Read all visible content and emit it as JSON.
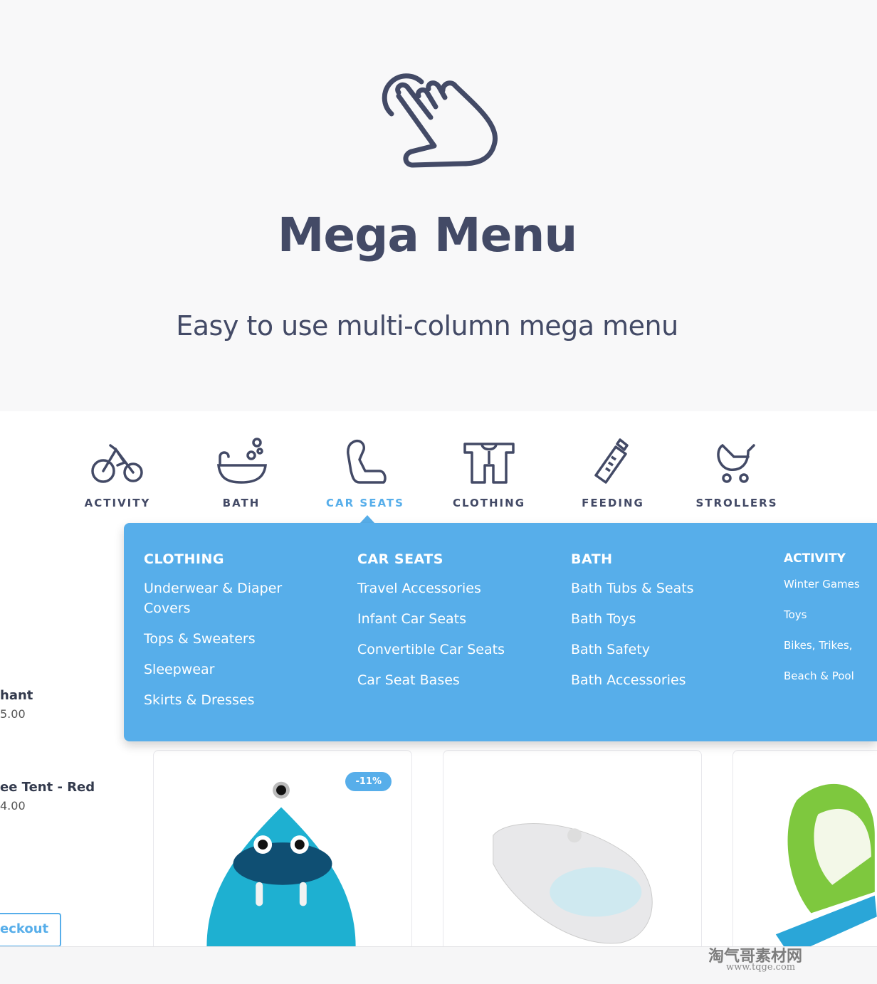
{
  "hero": {
    "title": "Mega Menu",
    "subtitle": "Easy to use multi-column mega menu",
    "icon": "hand-pointer-icon"
  },
  "nav": [
    {
      "label": "ACTIVITY",
      "icon": "bicycle-icon"
    },
    {
      "label": "BATH",
      "icon": "bathtub-icon"
    },
    {
      "label": "CAR SEATS",
      "icon": "car-seat-icon",
      "active": true
    },
    {
      "label": "CLOTHING",
      "icon": "onesie-icon"
    },
    {
      "label": "FEEDING",
      "icon": "baby-bottle-icon"
    },
    {
      "label": "STROLLERS",
      "icon": "stroller-icon"
    }
  ],
  "mega_menu": {
    "color": "#57aeea",
    "columns": [
      {
        "heading": "CLOTHING",
        "items": [
          "Underwear & Diaper Covers",
          "Tops & Sweaters",
          "Sleepwear",
          "Skirts & Dresses"
        ]
      },
      {
        "heading": "CAR SEATS",
        "items": [
          "Travel Accessories",
          "Infant Car Seats",
          "Convertible Car Seats",
          "Car Seat Bases"
        ]
      },
      {
        "heading": "BATH",
        "items": [
          "Bath Tubs & Seats",
          "Bath Toys",
          "Bath Safety",
          "Bath Accessories"
        ]
      },
      {
        "heading": "ACTIVITY",
        "items": [
          "Winter Games",
          "Toys",
          "Bikes, Trikes,",
          "Beach & Pool"
        ]
      }
    ]
  },
  "cart": {
    "items": [
      {
        "name": "hant",
        "price": "5.00"
      },
      {
        "name": "ee Tent - Red",
        "price": "4.00"
      }
    ],
    "checkout_label": "eckout"
  },
  "products": [
    {
      "badge": "-11%"
    },
    {},
    {}
  ],
  "watermark": {
    "line1": "淘气哥素材网",
    "line2": "www.tqge.com"
  }
}
